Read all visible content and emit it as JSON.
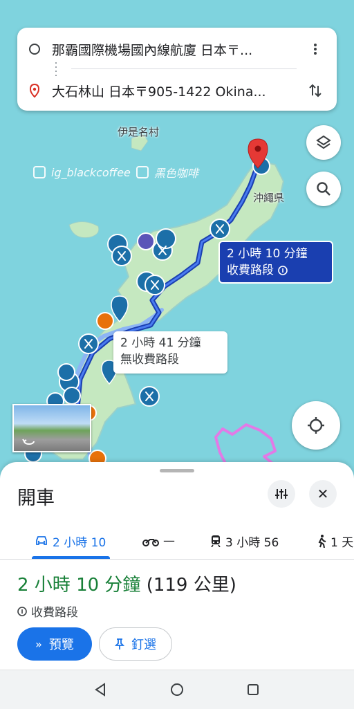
{
  "search": {
    "origin": "那霸國際機場國內線航廈 日本〒...",
    "destination": "大石林山 日本〒905-1422 Okina..."
  },
  "map": {
    "label_village": "伊是名村",
    "label_prefecture": "沖繩県",
    "watermark_ig": "ig_blackcoffee",
    "watermark_fb": "黑色咖啡",
    "route_main": {
      "line1": "2 小時 10 分鐘",
      "line2": "收費路段"
    },
    "route_alt": {
      "line1": "2 小時 41 分鐘",
      "line2": "無收費路段"
    }
  },
  "sheet": {
    "title": "開車",
    "tabs": [
      {
        "icon": "car-icon",
        "label": "2 小時 10"
      },
      {
        "icon": "motorcycle-icon",
        "label": "—"
      },
      {
        "icon": "transit-icon",
        "label": "3 小時 56"
      },
      {
        "icon": "walk-icon",
        "label": "1 天"
      }
    ],
    "summary_time": "2 小時 10 分鐘",
    "summary_distance": "(119 公里)",
    "toll_text": "收費路段",
    "preview_label": "預覽",
    "pin_label": "釘選"
  },
  "colors": {
    "accent": "#1a73e8",
    "route_primary": "#1a3fb0",
    "time_green": "#188038",
    "sea": "#7fd3de",
    "land": "#c5e8c0"
  }
}
